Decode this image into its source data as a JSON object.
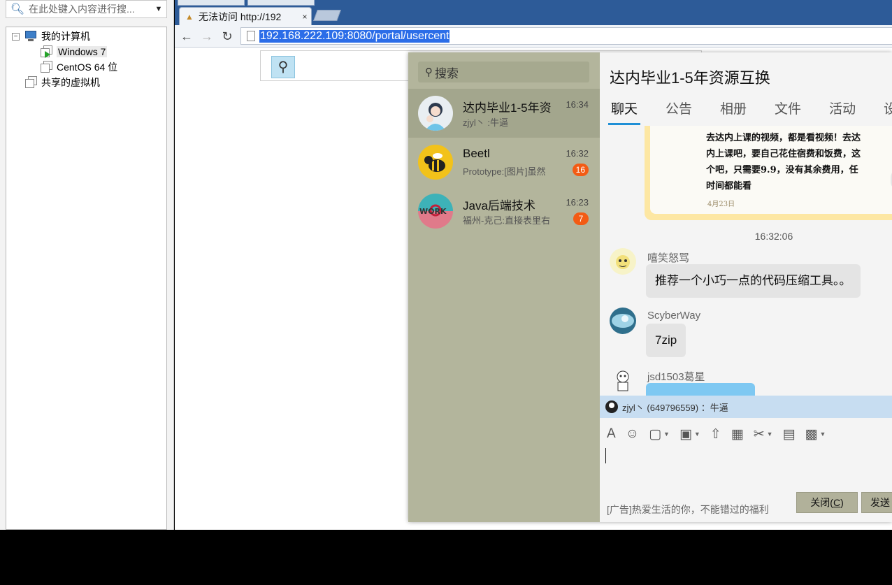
{
  "vm": {
    "search_placeholder": "在此处键入内容进行搜...",
    "tree": {
      "root": "我的计算机",
      "vms": [
        "Windows 7",
        "CentOS 64 位"
      ],
      "shared": "共享的虚拟机"
    }
  },
  "browser": {
    "tab_title": "无法访问 http://192",
    "tab_close": "×",
    "url": "192.168.222.109:8080/portal/usercent"
  },
  "chat": {
    "search_placeholder": "搜索",
    "conversations": [
      {
        "name": "达内毕业1-5年资",
        "time": "16:34",
        "preview": "zjyl丶 :牛逼",
        "badge": ""
      },
      {
        "name": "Beetl",
        "time": "16:32",
        "preview": "Prototype:[图片]虽然",
        "badge": "16"
      },
      {
        "name": "Java后端技术",
        "time": "16:23",
        "preview": "福州-克己:直接表里右",
        "badge": "7"
      }
    ],
    "group_title": "达内毕业1-5年资源互换",
    "tabs": [
      "聊天",
      "公告",
      "相册",
      "文件",
      "活动",
      "设置"
    ],
    "poster_lines": [
      "去达内上课的视频，都是看视频！去达",
      "内上课吧，要自己花住宿费和饭费，这",
      "个吧，只需要9.9，没有其余费用，任",
      "时间都能看"
    ],
    "poster_date": "4月23日",
    "timestamp": "16:32:06",
    "messages": [
      {
        "sender": "嘻笑怒骂",
        "text": "推荐一个小巧一点的代码压缩工具。。"
      },
      {
        "sender": "ScyberWay",
        "text": "7zip"
      },
      {
        "sender": "jsd1503葛星",
        "text": ""
      }
    ],
    "quote": "zjyl丶 (649796559) ：牛逼",
    "toolbar_icons": [
      "font-icon",
      "emoji-icon",
      "gif-icon",
      "image-icon",
      "upload-icon",
      "gift-icon",
      "scissors-icon",
      "archive-icon",
      "chat-history-icon"
    ],
    "ad_text": "[广告]热爱生活的你，不能错过的福利",
    "close_label": "关闭(",
    "close_key": "C",
    "close_tail": ")",
    "send_label": "发送"
  }
}
